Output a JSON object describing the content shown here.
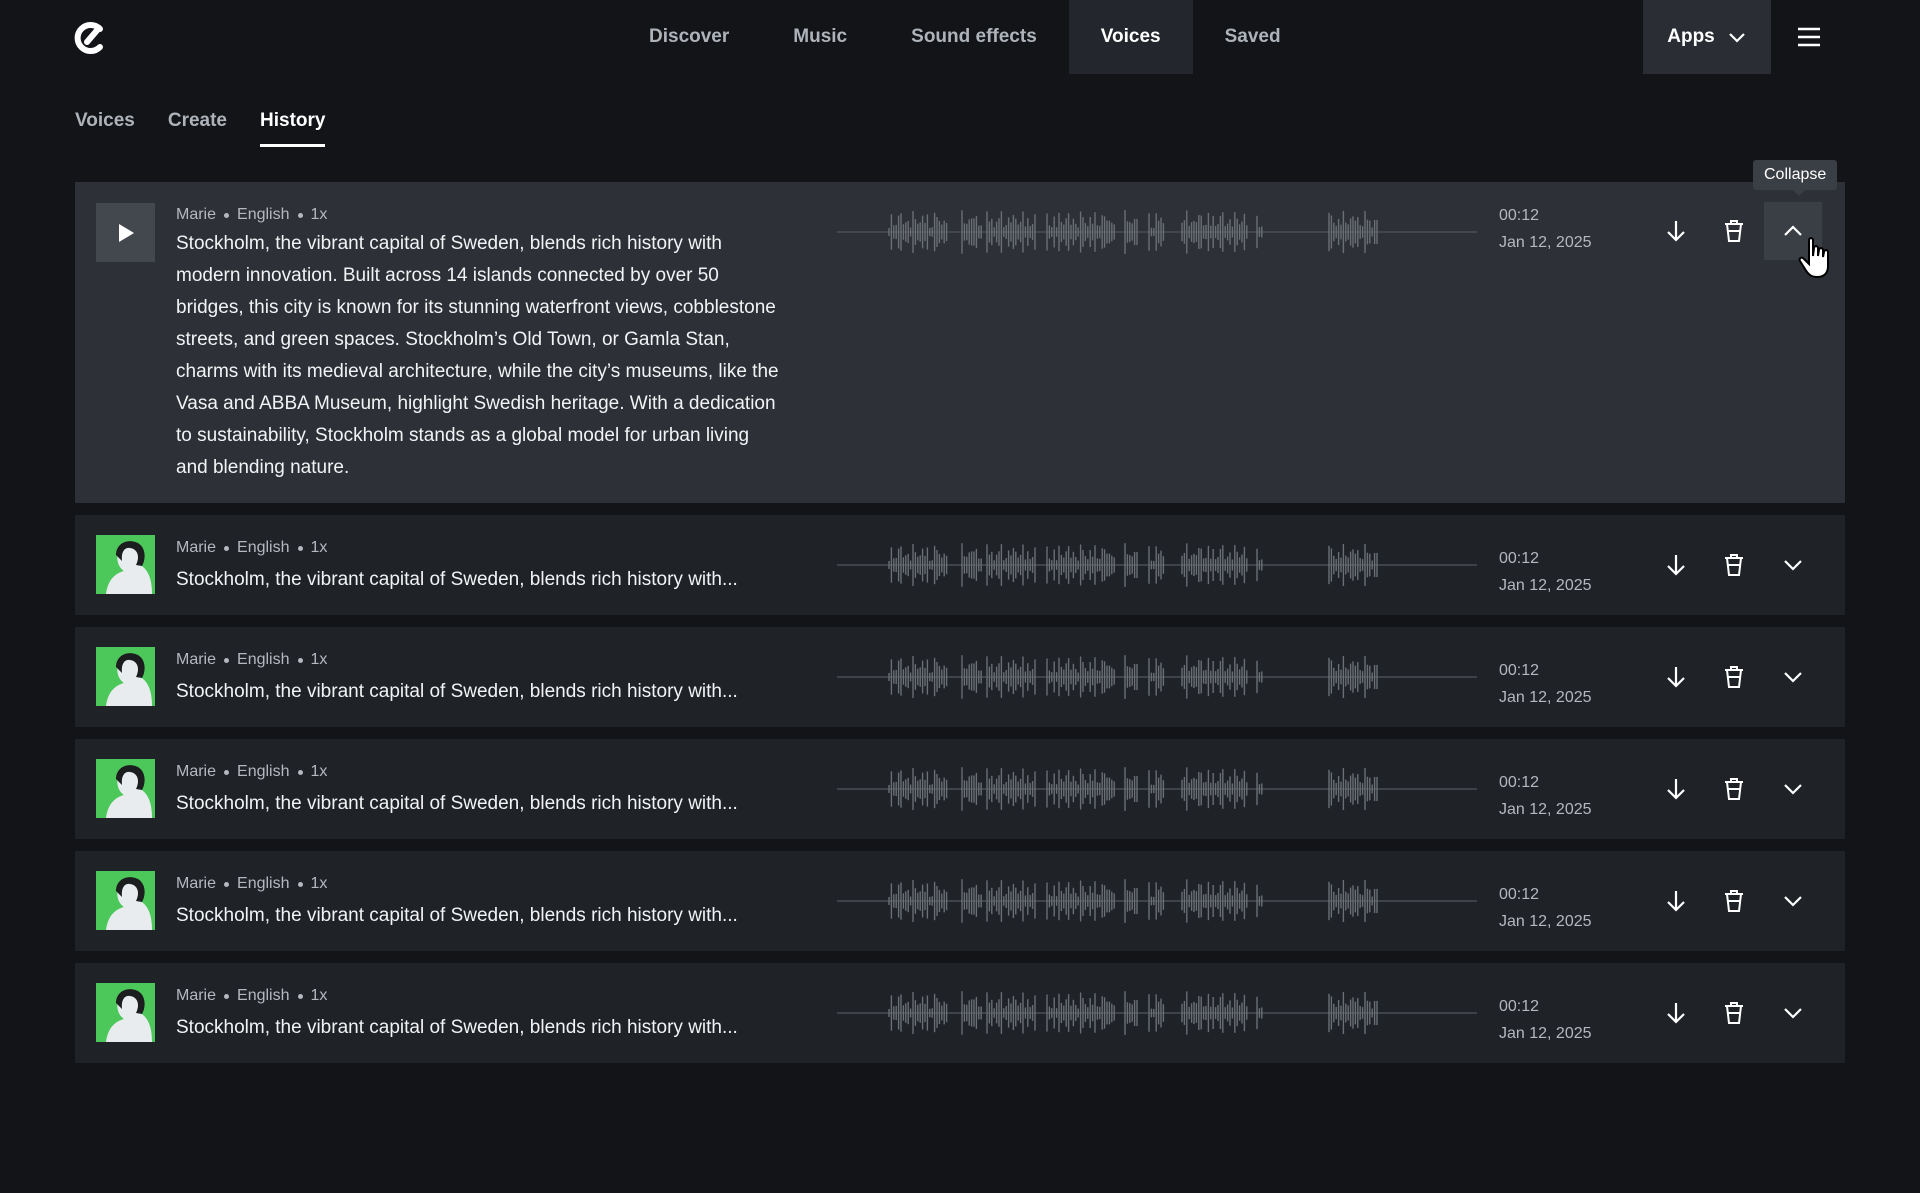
{
  "header": {
    "nav": [
      {
        "label": "Discover",
        "active": false
      },
      {
        "label": "Music",
        "active": false
      },
      {
        "label": "Sound effects",
        "active": false
      },
      {
        "label": "Voices",
        "active": true
      },
      {
        "label": "Saved",
        "active": false
      }
    ],
    "apps_label": "Apps"
  },
  "subtabs": [
    {
      "label": "Voices",
      "active": false
    },
    {
      "label": "Create",
      "active": false
    },
    {
      "label": "History",
      "active": true
    }
  ],
  "tooltip": "Collapse",
  "history": [
    {
      "voice": "Marie",
      "language": "English",
      "speed": "1x",
      "text": "Stockholm, the vibrant capital of Sweden, blends rich history with modern innovation. Built across 14 islands connected by over 50 bridges, this city is known for its stunning waterfront views, cobblestone streets, and green spaces. Stockholm’s Old Town, or Gamla Stan, charms with its medieval architecture, while the city’s museums, like the Vasa and ABBA Museum, highlight Swedish heritage. With a dedication to sustainability, Stockholm stands as a global model for urban living and blending nature.",
      "duration": "00:12",
      "date": "Jan 12, 2025",
      "expanded": true
    },
    {
      "voice": "Marie",
      "language": "English",
      "speed": "1x",
      "text": "Stockholm, the vibrant capital of Sweden, blends rich history with...",
      "duration": "00:12",
      "date": "Jan 12, 2025",
      "expanded": false
    },
    {
      "voice": "Marie",
      "language": "English",
      "speed": "1x",
      "text": "Stockholm, the vibrant capital of Sweden, blends rich history with...",
      "duration": "00:12",
      "date": "Jan 12, 2025",
      "expanded": false
    },
    {
      "voice": "Marie",
      "language": "English",
      "speed": "1x",
      "text": "Stockholm, the vibrant capital of Sweden, blends rich history with...",
      "duration": "00:12",
      "date": "Jan 12, 2025",
      "expanded": false
    },
    {
      "voice": "Marie",
      "language": "English",
      "speed": "1x",
      "text": "Stockholm, the vibrant capital of Sweden, blends rich history with...",
      "duration": "00:12",
      "date": "Jan 12, 2025",
      "expanded": false
    },
    {
      "voice": "Marie",
      "language": "English",
      "speed": "1x",
      "text": "Stockholm, the vibrant capital of Sweden, blends rich history with...",
      "duration": "00:12",
      "date": "Jan 12, 2025",
      "expanded": false
    }
  ],
  "icons": {
    "logo": "brand-logo-icon",
    "apps": "chevron-down-icon",
    "menu": "hamburger-menu-icon",
    "play": "play-icon",
    "download": "download-icon",
    "delete": "trash-icon",
    "expand": "chevron-down-icon",
    "collapse": "chevron-up-icon",
    "cursor": "hand-pointer-icon"
  },
  "colors": {
    "background": "#121418",
    "row": "#1f2227",
    "row_expanded": "#2d3036",
    "thumb_green": "#4cc75a"
  }
}
